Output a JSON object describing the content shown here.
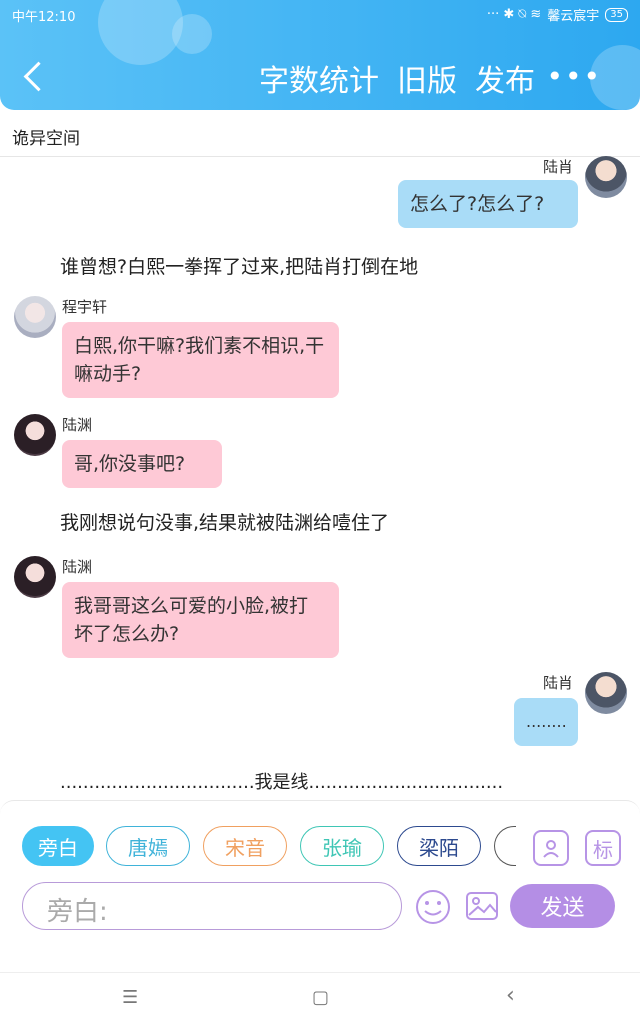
{
  "status_bar": {
    "time": "中午12:10",
    "icons": "··· ✱ ⍉ ≋",
    "carrier": "馨云宸宇",
    "battery": "35"
  },
  "header": {
    "back_icon": "back-chevron-icon",
    "actions": [
      "字数统计",
      "旧版",
      "发布"
    ],
    "more_label": "•••"
  },
  "space_title": "诡异空间",
  "messages": [
    {
      "type": "right",
      "name": "陆肖",
      "text": "怎么了?怎么了?"
    },
    {
      "type": "narration",
      "text": "谁曾想?白熙一拳挥了过来,把陆肖打倒在地"
    },
    {
      "type": "left",
      "name": "程宇轩",
      "text": "白熙,你干嘛?我们素不相识,干嘛动手?"
    },
    {
      "type": "left",
      "name": "陆渊",
      "text": "哥,你没事吧?"
    },
    {
      "type": "narration",
      "text": "我刚想说句没事,结果就被陆渊给噎住了"
    },
    {
      "type": "left",
      "name": "陆渊",
      "text": "我哥哥这么可爱的小脸,被打坏了怎么办?"
    },
    {
      "type": "right",
      "name": "陆肖",
      "text": "........"
    },
    {
      "type": "narration",
      "text": "..................................我是线.................................."
    }
  ],
  "composer": {
    "roles": [
      "旁白",
      "唐嫣",
      "宋音",
      "张瑜",
      "梁陌"
    ],
    "role_colors": [
      "#44c4f3",
      "#3fb3d9",
      "#f0a060",
      "#3fc6b5",
      "#2d4a8f"
    ],
    "tool_icons": [
      "person-icon",
      "标"
    ],
    "input_placeholder": "旁白:",
    "send_label": "发送"
  },
  "nav_bar": {
    "menu": "☰",
    "home": "▢",
    "back": "‹"
  }
}
